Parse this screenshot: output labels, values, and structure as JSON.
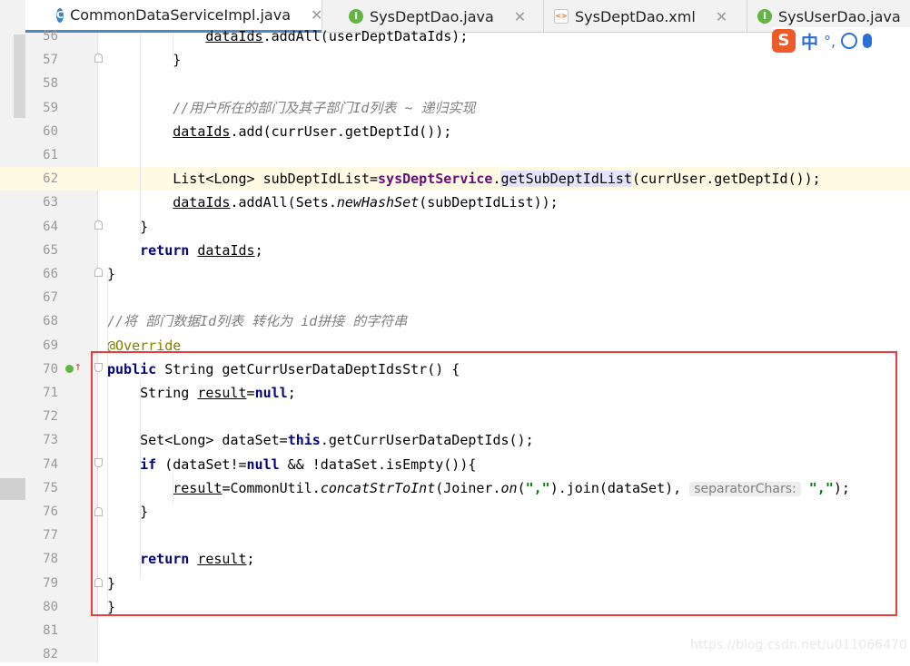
{
  "tabs": [
    {
      "label": "CommonDataServiceImpl.java",
      "icon": "class-icon",
      "active": true
    },
    {
      "label": "SysDeptDao.java",
      "icon": "interface-icon",
      "active": false
    },
    {
      "label": "SysDeptDao.xml",
      "icon": "xml-icon",
      "active": false
    },
    {
      "label": "SysUserDao.java",
      "icon": "interface-icon",
      "active": false
    }
  ],
  "close_glyph": "✕",
  "ime": {
    "logo": "S",
    "mode": "中",
    "punct": "°,"
  },
  "lines": [
    {
      "n": "56",
      "parts": [
        {
          "t": "            "
        },
        {
          "t": "dataIds",
          "c": "ul"
        },
        {
          "t": ".addAll(userDeptDataIds);"
        }
      ]
    },
    {
      "n": "57",
      "parts": [
        {
          "t": "        }"
        }
      ]
    },
    {
      "n": "58",
      "parts": [
        {
          "t": ""
        }
      ]
    },
    {
      "n": "59",
      "parts": [
        {
          "t": "        "
        },
        {
          "t": "//用户所在的部门及其子部门Id列表 ~ 递归实现",
          "c": "cm"
        }
      ]
    },
    {
      "n": "60",
      "parts": [
        {
          "t": "        "
        },
        {
          "t": "dataIds",
          "c": "ul"
        },
        {
          "t": ".add(currUser.getDeptId());"
        }
      ]
    },
    {
      "n": "61",
      "parts": [
        {
          "t": ""
        }
      ]
    },
    {
      "n": "62",
      "current": true,
      "parts": [
        {
          "t": "        List<Long> subDeptIdList="
        },
        {
          "t": "sysDeptService",
          "c": "fld"
        },
        {
          "t": "."
        },
        {
          "t": "getSubDeptIdList",
          "c": "hl"
        },
        {
          "t": "(currUser.getDeptId());"
        }
      ]
    },
    {
      "n": "63",
      "parts": [
        {
          "t": "        "
        },
        {
          "t": "dataIds",
          "c": "ul"
        },
        {
          "t": ".addAll(Sets."
        },
        {
          "t": "newHashSet",
          "c": "it"
        },
        {
          "t": "(subDeptIdList));"
        }
      ]
    },
    {
      "n": "64",
      "parts": [
        {
          "t": "    }"
        }
      ]
    },
    {
      "n": "65",
      "parts": [
        {
          "t": "    "
        },
        {
          "t": "return",
          "c": "kw"
        },
        {
          "t": " "
        },
        {
          "t": "dataIds",
          "c": "ul"
        },
        {
          "t": ";"
        }
      ]
    },
    {
      "n": "66",
      "parts": [
        {
          "t": "}"
        }
      ]
    },
    {
      "n": "67",
      "parts": [
        {
          "t": ""
        }
      ]
    },
    {
      "n": "68",
      "parts": [
        {
          "t": "//将 部门数据Id列表 转化为 id拼接 的字符串",
          "c": "cm"
        }
      ]
    },
    {
      "n": "69",
      "parts": [
        {
          "t": "@Override",
          "c": "ann"
        }
      ]
    },
    {
      "n": "70",
      "parts": [
        {
          "t": "public",
          "c": "kw"
        },
        {
          "t": " String getCurrUserDataDeptIdsStr() {"
        }
      ]
    },
    {
      "n": "71",
      "parts": [
        {
          "t": "    String "
        },
        {
          "t": "result",
          "c": "ul"
        },
        {
          "t": "="
        },
        {
          "t": "null",
          "c": "kw"
        },
        {
          "t": ";"
        }
      ]
    },
    {
      "n": "72",
      "parts": [
        {
          "t": ""
        }
      ]
    },
    {
      "n": "73",
      "parts": [
        {
          "t": "    Set<Long> dataSet="
        },
        {
          "t": "this",
          "c": "kw"
        },
        {
          "t": ".getCurrUserDataDeptIds();"
        }
      ]
    },
    {
      "n": "74",
      "parts": [
        {
          "t": "    "
        },
        {
          "t": "if",
          "c": "kw"
        },
        {
          "t": " (dataSet!="
        },
        {
          "t": "null",
          "c": "kw"
        },
        {
          "t": " && !dataSet.isEmpty()){"
        }
      ]
    },
    {
      "n": "75",
      "parts": [
        {
          "t": "        "
        },
        {
          "t": "result",
          "c": "ul"
        },
        {
          "t": "=CommonUtil."
        },
        {
          "t": "concatStrToInt",
          "c": "it"
        },
        {
          "t": "(Joiner."
        },
        {
          "t": "on",
          "c": "it"
        },
        {
          "t": "("
        },
        {
          "t": "\",\"",
          "c": "str"
        },
        {
          "t": ").join(dataSet), "
        },
        {
          "t": "separatorChars:",
          "c": "hint"
        },
        {
          "t": " "
        },
        {
          "t": "\",\"",
          "c": "str"
        },
        {
          "t": ");"
        }
      ]
    },
    {
      "n": "76",
      "parts": [
        {
          "t": "    }"
        }
      ]
    },
    {
      "n": "77",
      "parts": [
        {
          "t": ""
        }
      ]
    },
    {
      "n": "78",
      "parts": [
        {
          "t": "    "
        },
        {
          "t": "return",
          "c": "kw"
        },
        {
          "t": " "
        },
        {
          "t": "result",
          "c": "ul"
        },
        {
          "t": ";"
        }
      ]
    },
    {
      "n": "79",
      "parts": [
        {
          "t": "}"
        }
      ]
    },
    {
      "n": "80",
      "parts": [
        {
          "t": "}"
        }
      ]
    },
    {
      "n": "81",
      "parts": [
        {
          "t": ""
        }
      ]
    },
    {
      "n": "82",
      "parts": [
        {
          "t": ""
        }
      ]
    }
  ],
  "watermark": "https://blog.csdn.net/u011066470"
}
